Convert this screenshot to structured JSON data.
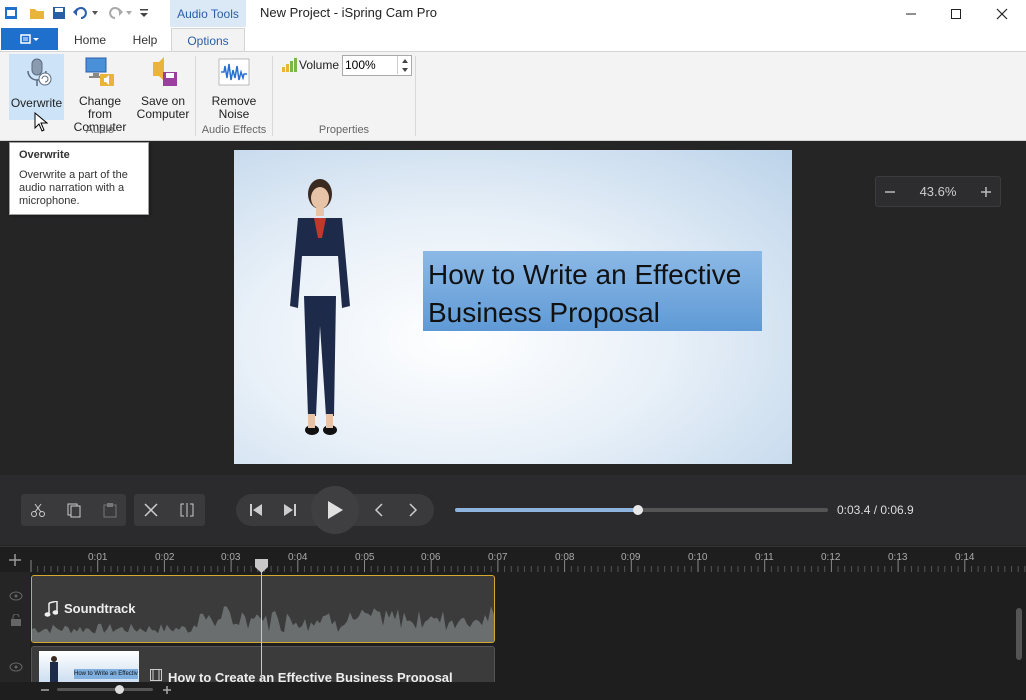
{
  "window": {
    "title": "New Project - iSpring Cam Pro",
    "context_tab": "Audio Tools"
  },
  "ribbon": {
    "tabs": [
      {
        "label": "Home"
      },
      {
        "label": "Help"
      },
      {
        "label": "Options",
        "active": true
      }
    ],
    "groups": {
      "audio": {
        "label": "Audio"
      },
      "effects": {
        "label": "Audio Effects"
      },
      "properties": {
        "label": "Properties"
      }
    },
    "buttons": {
      "overwrite": {
        "line1": "Overwrite",
        "line2": ""
      },
      "change_from_computer": {
        "line1": "Change from",
        "line2": "Computer"
      },
      "save_on_computer": {
        "line1": "Save on",
        "line2": "Computer"
      },
      "remove_noise": {
        "line1": "Remove",
        "line2": "Noise"
      }
    },
    "volume": {
      "label": "Volume",
      "value": "100%"
    }
  },
  "tooltip": {
    "title": "Overwrite",
    "body": "Overwrite a part of the audio narration with a microphone."
  },
  "canvas": {
    "slide_title": "How to Write an Effective Business Proposal",
    "zoom": "43.6%"
  },
  "player": {
    "time": "0:03.4 / 0:06.9",
    "progress": 0.49
  },
  "timeline": {
    "ticks": [
      "0:01",
      "0:02",
      "0:03",
      "0:04",
      "0:05",
      "0:06",
      "0:07",
      "0:08",
      "0:09",
      "0:10",
      "0:11",
      "0:12",
      "0:13",
      "0:14"
    ],
    "audio_track": {
      "label": "Soundtrack"
    },
    "video_track": {
      "label": "How to Create an Effective Business Proposal",
      "thumb_text": "How to Write an Effective"
    }
  },
  "colors": {
    "accent": "#1f6fcc",
    "audio_border": "#d4a92e",
    "seek_fill": "#8db4dc"
  }
}
